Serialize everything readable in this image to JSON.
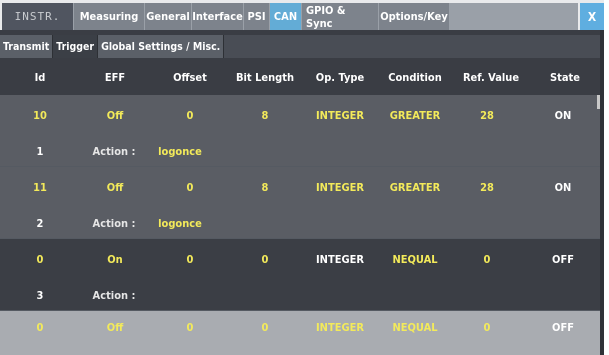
{
  "top_tabs": {
    "instr": "INSTR.",
    "items": [
      "Measuring",
      "General",
      "Interface",
      "PSI",
      "CAN",
      "GPIO & Sync",
      "Options/Key"
    ],
    "active": "CAN",
    "close_label": "X"
  },
  "sub_tabs": {
    "items": [
      "Transmit",
      "Trigger",
      "Global Settings / Misc."
    ],
    "active": "Trigger"
  },
  "columns": [
    "Id",
    "EFF",
    "Offset",
    "Bit Length",
    "Op. Type",
    "Condition",
    "Ref. Value",
    "State"
  ],
  "rows": [
    {
      "id": "10",
      "eff": "Off",
      "offset": "0",
      "bitlen": "8",
      "optype": "INTEGER",
      "condition": "GREATER",
      "ref": "28",
      "state": "ON",
      "num": "1",
      "action_label": "Action :",
      "action": "logonce"
    },
    {
      "id": "11",
      "eff": "Off",
      "offset": "0",
      "bitlen": "8",
      "optype": "INTEGER",
      "condition": "GREATER",
      "ref": "28",
      "state": "ON",
      "num": "2",
      "action_label": "Action :",
      "action": "logonce"
    },
    {
      "id": "0",
      "eff": "On",
      "offset": "0",
      "bitlen": "0",
      "optype": "INTEGER",
      "condition": "NEQUAL",
      "ref": "0",
      "state": "OFF",
      "num": "3",
      "action_label": "Action :",
      "action": ""
    },
    {
      "id": "0",
      "eff": "Off",
      "offset": "0",
      "bitlen": "0",
      "optype": "INTEGER",
      "condition": "NEQUAL",
      "ref": "0",
      "state": "OFF"
    }
  ]
}
